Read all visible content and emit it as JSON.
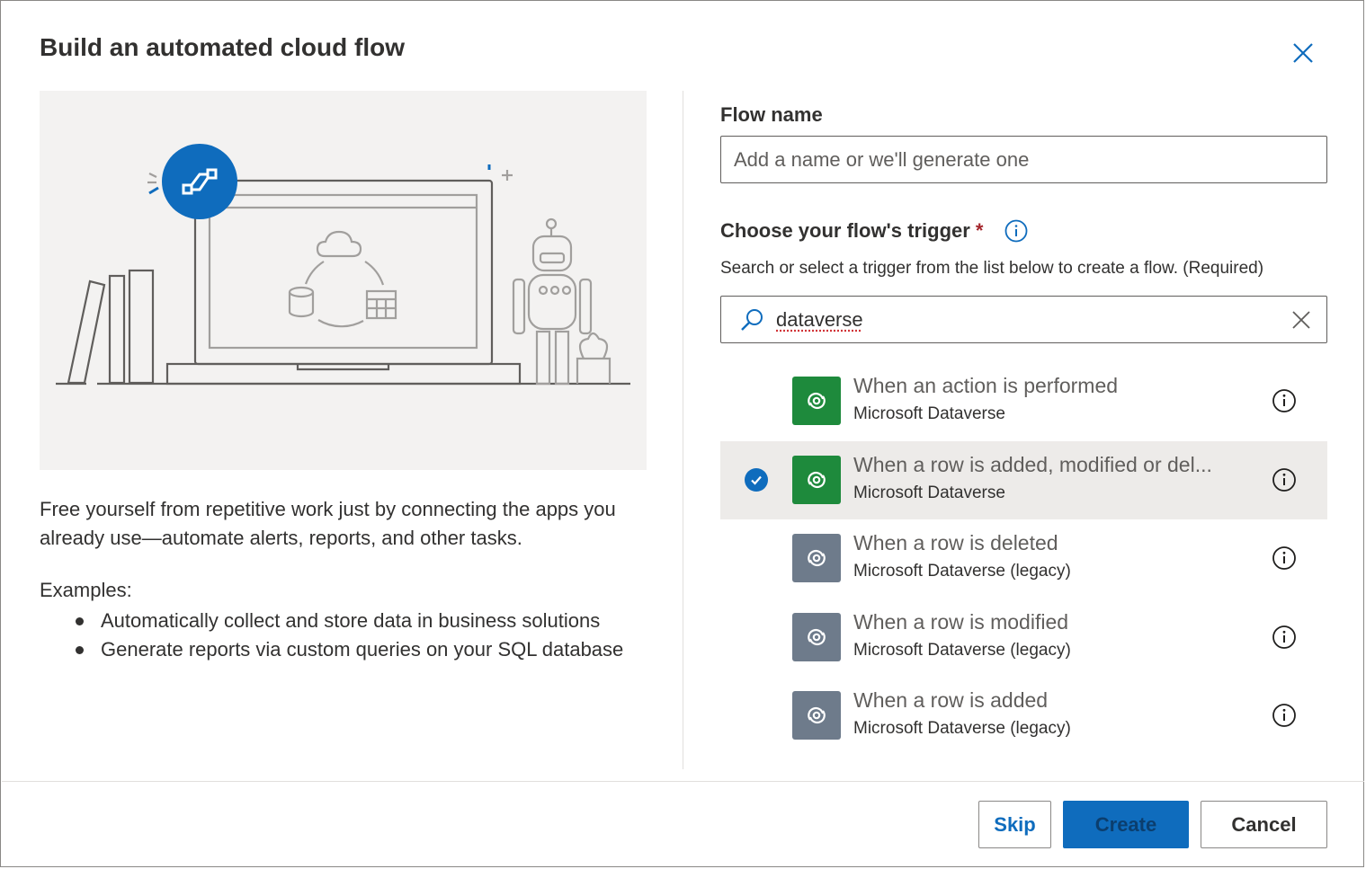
{
  "dialog": {
    "title": "Build an automated cloud flow",
    "close_icon": "close-icon"
  },
  "left": {
    "description": "Free yourself from repetitive work just by connecting the apps you already use—automate alerts, reports, and other tasks.",
    "examples_label": "Examples:",
    "examples": [
      "Automatically collect and store data in business solutions",
      "Generate reports via custom queries on your SQL database"
    ]
  },
  "form": {
    "flow_name_label": "Flow name",
    "flow_name_placeholder": "Add a name or we'll generate one",
    "flow_name_value": "",
    "trigger_label": "Choose your flow's trigger",
    "required_marker": "*",
    "helper_text": "Search or select a trigger from the list below to create a flow. (Required)",
    "search_value": "dataverse"
  },
  "triggers": [
    {
      "title": "When an action is performed",
      "connector": "Microsoft Dataverse",
      "selected": false,
      "color": "#1e8a3c"
    },
    {
      "title": "When a row is added, modified or del...",
      "connector": "Microsoft Dataverse",
      "selected": true,
      "color": "#1e8a3c"
    },
    {
      "title": "When a row is deleted",
      "connector": "Microsoft Dataverse (legacy)",
      "selected": false,
      "color": "#6e7b8b"
    },
    {
      "title": "When a row is modified",
      "connector": "Microsoft Dataverse (legacy)",
      "selected": false,
      "color": "#6e7b8b"
    },
    {
      "title": "When a row is added",
      "connector": "Microsoft Dataverse (legacy)",
      "selected": false,
      "color": "#6e7b8b"
    }
  ],
  "footer": {
    "skip_label": "Skip",
    "create_label": "Create",
    "cancel_label": "Cancel"
  },
  "colors": {
    "accent": "#0f6cbd",
    "dataverse_green": "#1e8a3c",
    "legacy_gray": "#6e7b8b",
    "selected_row": "#edebe9"
  }
}
